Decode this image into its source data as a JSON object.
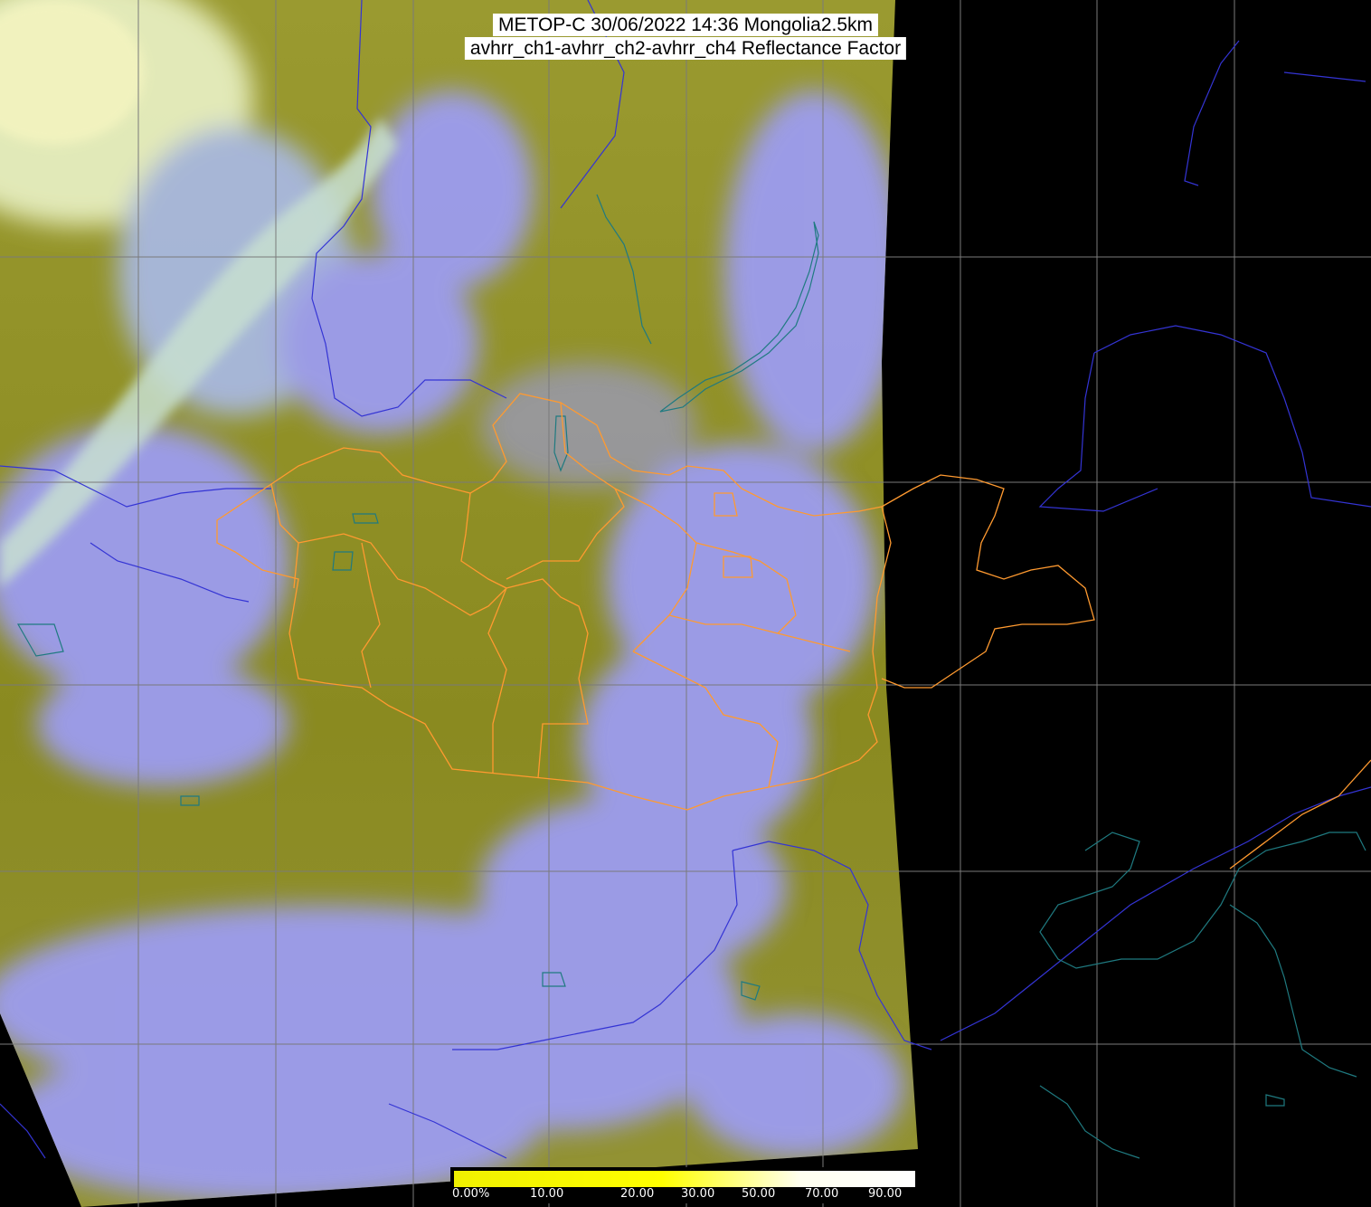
{
  "header": {
    "line1": "METOP-C 30/06/2022 14:36 Mongolia2.5km",
    "line2": "avhrr_ch1-avhrr_ch2-avhrr_ch4 Reflectance Factor"
  },
  "colorbar": {
    "labels": [
      "0.00%",
      "10.00",
      "20.00",
      "30.00",
      "50.00",
      "70.00",
      "90.00"
    ],
    "colors": [
      "#f0f000",
      "#ffff00",
      "#fffff0",
      "#ffffff"
    ]
  },
  "map": {
    "colors": {
      "land_olive": "#8f8f2a",
      "cloud_lavender": "#9a9af2",
      "high_cloud_white": "#e8f0c8",
      "no_data": "#000000",
      "graticule": "#7a7a7a",
      "country_border": "#3030d0",
      "province_border": "#ff9a30",
      "coastline": "#1a6a7a"
    }
  }
}
